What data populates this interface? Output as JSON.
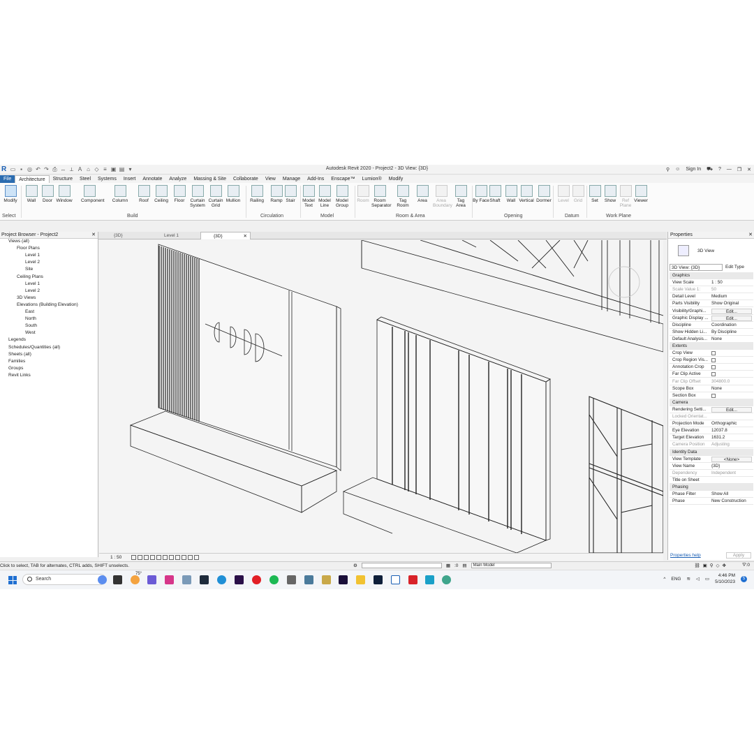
{
  "window": {
    "title": "Autodesk Revit 2020 - Project2 - 3D View: {3D}",
    "sign_in": "Sign In",
    "help": "?"
  },
  "ribbon_tabs": [
    "File",
    "Architecture",
    "Structure",
    "Steel",
    "Systems",
    "Insert",
    "Annotate",
    "Analyze",
    "Massing & Site",
    "Collaborate",
    "View",
    "Manage",
    "Add-Ins",
    "Enscape™",
    "Lumion®",
    "Modify"
  ],
  "ribbon": {
    "select_label": "Select",
    "buttons": [
      {
        "label": "Modify",
        "icon": "cursor-icon"
      },
      {
        "label": "Wall",
        "icon": "wall-icon"
      },
      {
        "label": "Door",
        "icon": "door-icon"
      },
      {
        "label": "Window",
        "icon": "window-icon"
      },
      {
        "label": "Component",
        "icon": "component-icon"
      },
      {
        "label": "Column",
        "icon": "column-icon"
      },
      {
        "label": "Roof",
        "icon": "roof-icon"
      },
      {
        "label": "Ceiling",
        "icon": "ceiling-icon"
      },
      {
        "label": "Floor",
        "icon": "floor-icon"
      },
      {
        "label": "Curtain System",
        "icon": "curtain-system-icon"
      },
      {
        "label": "Curtain Grid",
        "icon": "curtain-grid-icon"
      },
      {
        "label": "Mullion",
        "icon": "mullion-icon"
      },
      {
        "label": "Railing",
        "icon": "railing-icon"
      },
      {
        "label": "Ramp",
        "icon": "ramp-icon"
      },
      {
        "label": "Stair",
        "icon": "stair-icon"
      },
      {
        "label": "Model Text",
        "icon": "model-text-icon"
      },
      {
        "label": "Model Line",
        "icon": "model-line-icon"
      },
      {
        "label": "Model Group",
        "icon": "model-group-icon"
      },
      {
        "label": "Room",
        "icon": "room-icon"
      },
      {
        "label": "Room Separator",
        "icon": "room-separator-icon"
      },
      {
        "label": "Tag Room",
        "icon": "tag-room-icon"
      },
      {
        "label": "Area",
        "icon": "area-icon"
      },
      {
        "label": "Area Boundary",
        "icon": "area-boundary-icon"
      },
      {
        "label": "Tag Area",
        "icon": "tag-area-icon"
      },
      {
        "label": "By Face",
        "icon": "by-face-icon"
      },
      {
        "label": "Shaft",
        "icon": "shaft-icon"
      },
      {
        "label": "Wall",
        "icon": "wall-opening-icon"
      },
      {
        "label": "Vertical",
        "icon": "vertical-icon"
      },
      {
        "label": "Dormer",
        "icon": "dormer-icon"
      },
      {
        "label": "Level",
        "icon": "level-icon"
      },
      {
        "label": "Grid",
        "icon": "grid-icon"
      },
      {
        "label": "Set",
        "icon": "set-icon"
      },
      {
        "label": "Show",
        "icon": "show-icon"
      },
      {
        "label": "Ref Plane",
        "icon": "ref-plane-icon"
      },
      {
        "label": "Viewer",
        "icon": "viewer-icon"
      }
    ],
    "panels": [
      "Build",
      "Circulation",
      "Model",
      "Room & Area",
      "Opening",
      "Datum",
      "Work Plane"
    ]
  },
  "project_browser": {
    "title": "Project Browser - Project2",
    "items": [
      "Views (all)",
      "Floor Plans",
      "Level 1",
      "Level 2",
      "Site",
      "Ceiling Plans",
      "Level 1",
      "Level 2",
      "3D Views",
      "Elevations (Building Elevation)",
      "East",
      "North",
      "South",
      "West",
      "Legends",
      "Schedules/Quantities (all)",
      "Sheets (all)",
      "Families",
      "Groups",
      "Revit Links"
    ]
  },
  "view_tabs": [
    "{3D}",
    "Level 1",
    "{3D}"
  ],
  "view_bar": {
    "scale": "1 : 50"
  },
  "properties": {
    "title": "Properties",
    "type_name": "3D View",
    "filter": "3D View: {3D}",
    "edit_type": "Edit Type",
    "rows": [
      {
        "kind": "section",
        "k": "Graphics"
      },
      {
        "k": "View Scale",
        "v": "1 : 50"
      },
      {
        "k": "Scale Value  1:",
        "v": "50",
        "dis": true
      },
      {
        "k": "Detail Level",
        "v": "Medium"
      },
      {
        "k": "Parts Visibility",
        "v": "Show Original"
      },
      {
        "k": "Visibility/Graphi...",
        "v": "Edit...",
        "btn": true
      },
      {
        "k": "Graphic Display ...",
        "v": "Edit...",
        "btn": true
      },
      {
        "k": "Discipline",
        "v": "Coordination"
      },
      {
        "k": "Show Hidden Li...",
        "v": "By Discipline"
      },
      {
        "k": "Default Analysis...",
        "v": "None"
      },
      {
        "kind": "section",
        "k": "Extents"
      },
      {
        "k": "Crop View",
        "v": "",
        "box": true
      },
      {
        "k": "Crop Region Vis...",
        "v": "",
        "box": true
      },
      {
        "k": "Annotation Crop",
        "v": "",
        "box": true
      },
      {
        "k": "Far Clip Active",
        "v": "",
        "box": true
      },
      {
        "k": "Far Clip Offset",
        "v": "304800.0",
        "dis": true
      },
      {
        "k": "Scope Box",
        "v": "None"
      },
      {
        "k": "Section Box",
        "v": "",
        "box": true
      },
      {
        "kind": "section",
        "k": "Camera"
      },
      {
        "k": "Rendering Setti...",
        "v": "Edit...",
        "btn": true
      },
      {
        "k": "Locked Orientat...",
        "v": "",
        "dis": true
      },
      {
        "k": "Projection Mode",
        "v": "Orthographic"
      },
      {
        "k": "Eye Elevation",
        "v": "12037.8"
      },
      {
        "k": "Target Elevation",
        "v": "1631.2"
      },
      {
        "k": "Camera Position",
        "v": "Adjusting",
        "dis": true
      },
      {
        "kind": "section",
        "k": "Identity Data"
      },
      {
        "k": "View Template",
        "v": "<None>",
        "btn": true
      },
      {
        "k": "View Name",
        "v": "{3D}"
      },
      {
        "k": "Dependency",
        "v": "Independent",
        "dis": true
      },
      {
        "k": "Title on Sheet",
        "v": ""
      },
      {
        "kind": "section",
        "k": "Phasing"
      },
      {
        "k": "Phase Filter",
        "v": "Show All"
      },
      {
        "k": "Phase",
        "v": "New Construction"
      }
    ],
    "help_link": "Properties help",
    "apply": "Apply"
  },
  "status_bar": {
    "message": "Click to select, TAB for alternates, CTRL adds, SHIFT unselects.",
    "zero": ":0",
    "model": "Main Model",
    "filter_count": ":0"
  },
  "taskbar": {
    "search": "Search",
    "weather": "75°",
    "lang": "ENG",
    "time": "4:46 PM",
    "date": "5/10/2023",
    "notif": "5"
  }
}
